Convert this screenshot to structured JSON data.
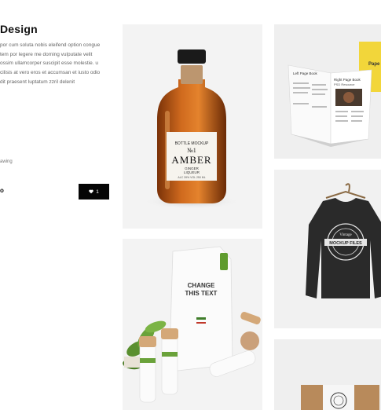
{
  "project": {
    "title": "Design",
    "description_lines": [
      "por cum soluta nobis eleifend option congue",
      "tem por legere me doming vulputate velit",
      "ossim ullamcorper suscipit esse molestie. u",
      "cilisis at vero eros et accumsan et iusto odio",
      "dit praesent luptatum zzril delenit"
    ],
    "meta_text": "awing",
    "cut_glyph": "o",
    "likes": {
      "icon": "heart-icon",
      "count": "1"
    }
  },
  "portfolio": {
    "bottle": {
      "label_top": "BOTTLE MOCKUP",
      "label_no": "№1",
      "label_name": "AMBER",
      "label_sub1": "GINGER",
      "label_sub2": "LIQUEUR",
      "label_small": "ALC 39% VOL 250 ML"
    },
    "book": {
      "left_page_title": "Left Page Book",
      "right_page_title": "Right Page Book",
      "right_page_subtitle": "PSD Resource",
      "side_text": "Pape"
    },
    "pack": {
      "bag_text_line1": "CHANGE",
      "bag_text_line2": "THIS TEXT"
    },
    "sweatshirt": {
      "badge_top": "Vintage",
      "badge_main": "MOCKUP FILES"
    }
  },
  "colors": {
    "accent_dark": "#050505",
    "amber": "#c4601a",
    "sweatshirt": "#2a2a2a",
    "book_yellow": "#f2d63a"
  }
}
